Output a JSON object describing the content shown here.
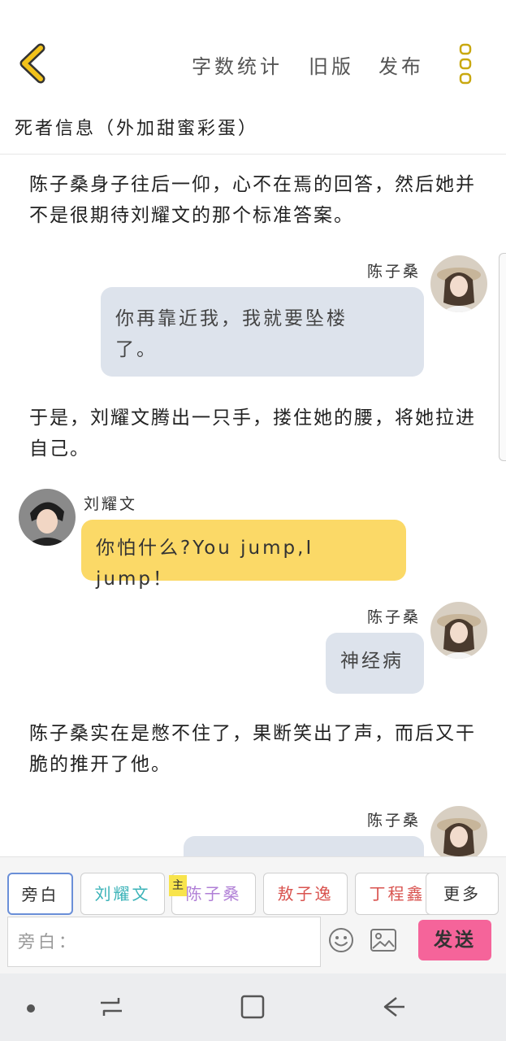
{
  "header": {
    "word_count_label": "字数统计",
    "old_version_label": "旧版",
    "publish_label": "发布",
    "story_title": "死者信息（外加甜蜜彩蛋）"
  },
  "messages": {
    "n1": "陈子桑身子往后一仰，心不在焉的回答，然后她并不是很期待刘耀文的那个标准答案。",
    "m1_name": "陈子桑",
    "m1_text": "你再靠近我，我就要坠楼了。",
    "n2": "于是，刘耀文腾出一只手，搂住她的腰，将她拉进自己。",
    "m2_name": "刘耀文",
    "m2_text": "你怕什么?You jump,I jump！",
    "m3_name": "陈子桑",
    "m3_text": "神经病",
    "n3": "陈子桑实在是憋不住了，果断笑出了声，而后又干脆的推开了他。",
    "m4_name": "陈子桑"
  },
  "roles": {
    "narrator": "旁白",
    "liu": "刘耀文",
    "chen": "陈子桑",
    "main_tag": "主",
    "sa": "敖子逸",
    "ding": "丁程鑫",
    "more": "更多"
  },
  "role_colors": {
    "narrator": "#333333",
    "liu": "#3bb3b8",
    "chen": "#b07fd6",
    "sa": "#d9534f",
    "ding": "#d9534f",
    "more": "#333333",
    "active_border": "#6a8fd8"
  },
  "input": {
    "placeholder": "旁白："
  },
  "send_label": "发送",
  "colors": {
    "accent_yellow": "#f2c21b",
    "send_pink": "#f5649a",
    "bubble_grey": "#dde3ec",
    "bubble_yellow": "#fbd967"
  },
  "icons": [
    "chevron-left-icon",
    "more-vertical-icon",
    "emoji-icon",
    "image-icon",
    "recents-icon",
    "home-icon",
    "back-icon"
  ]
}
